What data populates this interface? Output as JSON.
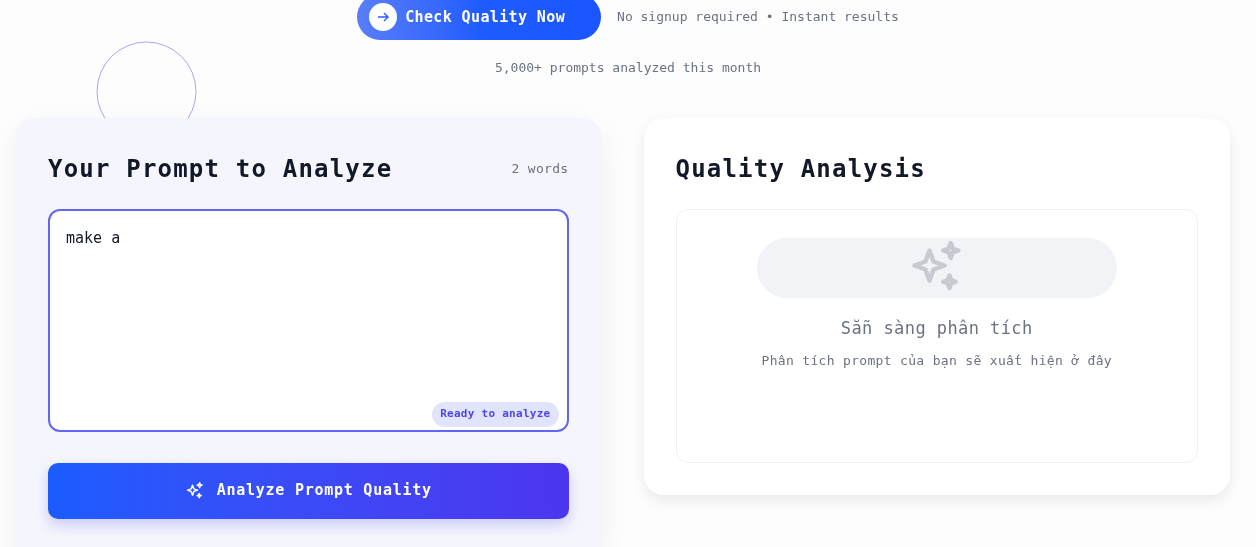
{
  "hero": {
    "cta_button": "Check Quality Now",
    "note": "No signup required • Instant results",
    "stats": "5,000+ prompts analyzed this month"
  },
  "input_panel": {
    "title": "Your Prompt to Analyze",
    "word_count": "2 words",
    "prompt_value": "make a ",
    "status_badge": "Ready to analyze",
    "submit_button": "Analyze Prompt Quality"
  },
  "analysis_panel": {
    "title": "Quality Analysis",
    "empty_title": "Sẵn sàng phân tích",
    "empty_message": "Phân tích prompt của bạn sẽ xuất hiện ở đây"
  }
}
